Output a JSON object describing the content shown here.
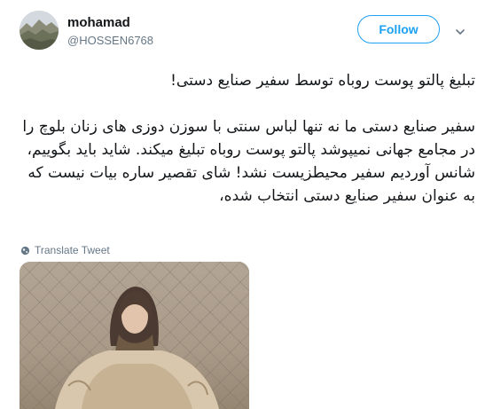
{
  "user": {
    "name": "mohamad",
    "handle": "@HOSSEN6768"
  },
  "actions": {
    "follow_label": "Follow"
  },
  "tweet": {
    "title": "تبلیغ پالتو پوست روباه توسط سفیر صنایع دستی!",
    "body": "سفیر صنایع دستی ما نه تنها لباس سنتی با سوزن دوزی های زنان بلوچ را در مجامع جهانی نمیپوشد پالتو پوست روباه تبلیغ میکند. شاید باید بگوییم، شانس آوردیم سفیر محیطزیست نشد! شای تقصیر ساره بیات نیست که به عنوان سفیر صنایع دستی انتخاب شده،",
    "translate_label": "Translate Tweet"
  },
  "colors": {
    "accent": "#1da1f2",
    "secondary_text": "#657786",
    "text": "#14171a"
  },
  "icons": {
    "avatar": "mountain-landscape-avatar",
    "menu": "chevron-down-icon",
    "translate": "globe-icon"
  }
}
